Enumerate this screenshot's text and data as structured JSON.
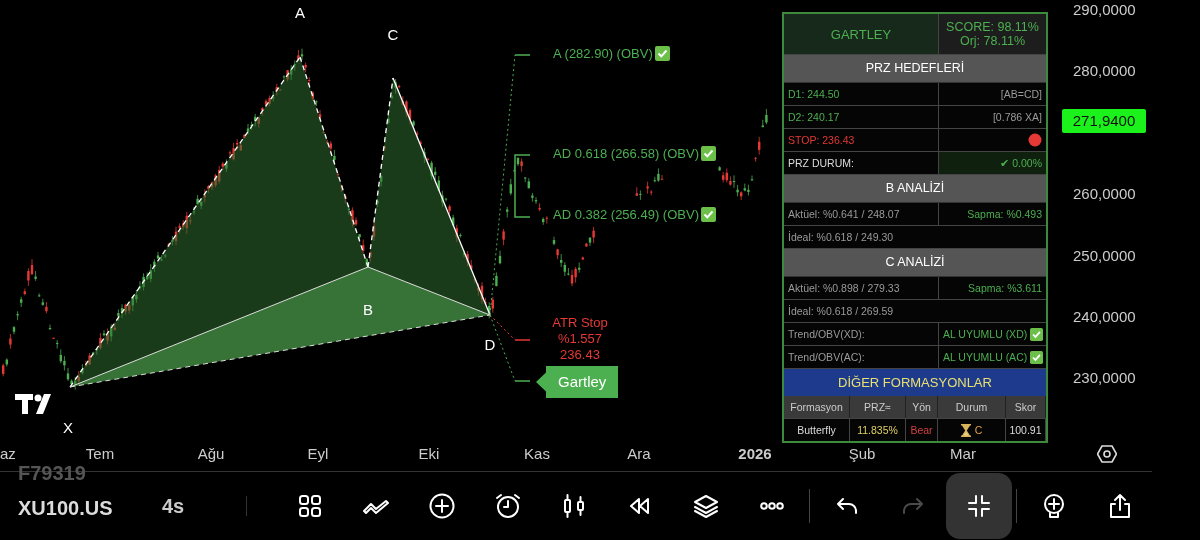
{
  "chart": {
    "pattern_points": [
      {
        "label": "A"
      },
      {
        "label": "C"
      },
      {
        "label": "B"
      },
      {
        "label": "D"
      },
      {
        "label": "X"
      }
    ],
    "annotations": [
      {
        "text": "A (282.90) (OBV)",
        "obv_ok": true
      },
      {
        "text": "AD 0.618 (266.58) (OBV)",
        "obv_ok": true
      },
      {
        "text": "AD 0.382 (256.49) (OBV)",
        "obv_ok": true
      }
    ],
    "stop_label": [
      "ATR Stop",
      "%1.557",
      "236.43"
    ],
    "pattern_name": "Gartley",
    "price_axis": [
      "290,0000",
      "280,0000",
      "260,0000",
      "250,0000",
      "240,0000",
      "230,0000"
    ],
    "current_price": "271,9400",
    "time_axis": [
      {
        "label": "az",
        "kind": "month"
      },
      {
        "label": "Tem",
        "kind": "month"
      },
      {
        "label": "Ağu",
        "kind": "month"
      },
      {
        "label": "Eyl",
        "kind": "month"
      },
      {
        "label": "Eki",
        "kind": "month"
      },
      {
        "label": "Kas",
        "kind": "month"
      },
      {
        "label": "Ara",
        "kind": "month"
      },
      {
        "label": "2026",
        "kind": "year"
      },
      {
        "label": "Şub",
        "kind": "month"
      },
      {
        "label": "Mar",
        "kind": "month"
      }
    ]
  },
  "panel": {
    "title": "GARTLEY",
    "score": "SCORE: 98.11%",
    "orj": "Orj: 78.11%",
    "rows": [
      {
        "kind": "section",
        "text": "PRZ HEDEFLERİ"
      },
      {
        "kind": "pair",
        "left": {
          "text": "D1: 244.50",
          "color": "#4caf50"
        },
        "right": {
          "text": "[AB=CD]",
          "color": "#9a9a9a"
        }
      },
      {
        "kind": "pair",
        "left": {
          "text": "D2: 240.17",
          "color": "#4caf50"
        },
        "right": {
          "text": "[0.786 XA]",
          "color": "#9a9a9a"
        }
      },
      {
        "kind": "stop",
        "left": {
          "text": "STOP: 236.43",
          "color": "#e53935"
        }
      },
      {
        "kind": "status",
        "left": {
          "text": "PRZ DURUM:",
          "color": "#dddddd"
        },
        "right": {
          "text": "✔ 0.00%",
          "color": "#4caf50"
        }
      },
      {
        "kind": "section",
        "text": "B ANALİZİ"
      },
      {
        "kind": "pair",
        "left": {
          "text": "Aktüel: %0.641 / 248.07",
          "color": "#9a9a9a"
        },
        "right": {
          "text": "Sapma: %0.493",
          "color": "#4caf50"
        }
      },
      {
        "kind": "single",
        "left": {
          "text": "İdeal: %0.618 / 249.30",
          "color": "#9a9a9a"
        }
      },
      {
        "kind": "section",
        "text": "C ANALİZİ"
      },
      {
        "kind": "pair",
        "left": {
          "text": "Aktüel: %0.898 / 279.33",
          "color": "#9a9a9a"
        },
        "right": {
          "text": "Sapma: %3.611",
          "color": "#4caf50"
        }
      },
      {
        "kind": "single",
        "left": {
          "text": "İdeal: %0.618 / 269.59",
          "color": "#9a9a9a"
        }
      },
      {
        "kind": "pair",
        "left": {
          "text": "Trend/OBV(XD):",
          "color": "#9a9a9a"
        },
        "right": {
          "text": "AL UYUMLU (XD)",
          "color": "#4caf50",
          "checked": true
        }
      },
      {
        "kind": "pair",
        "left": {
          "text": "Trend/OBV(AC):",
          "color": "#9a9a9a"
        },
        "right": {
          "text": "AL UYUMLU (AC)",
          "color": "#4caf50",
          "checked": true
        }
      }
    ],
    "others_title": "DİĞER FORMASYONLAR",
    "others_columns": [
      "Formasyon",
      "PRZ≈",
      "Yön",
      "Durum",
      "Skor"
    ],
    "others_rows": [
      {
        "name": "Butterfly",
        "prz": "11.835%",
        "direction": "Bear",
        "status": "C",
        "score": "100.91"
      }
    ]
  },
  "bottom_bar": {
    "symbol_above": "F79319",
    "symbol": "XU100.US",
    "interval": "4s",
    "tool_groups": [
      [
        {
          "kind": "grid",
          "selected": false,
          "disabled": false
        },
        {
          "kind": "draw",
          "selected": false,
          "disabled": false
        },
        {
          "kind": "plus",
          "selected": false,
          "disabled": false
        },
        {
          "kind": "alarm",
          "selected": false,
          "disabled": false
        },
        {
          "kind": "candles",
          "selected": false,
          "disabled": false
        },
        {
          "kind": "rewind",
          "selected": false,
          "disabled": false
        },
        {
          "kind": "layers",
          "selected": false,
          "disabled": false
        },
        {
          "kind": "more",
          "selected": false,
          "disabled": false
        }
      ],
      [
        {
          "kind": "undo",
          "selected": false,
          "disabled": false
        },
        {
          "kind": "redo",
          "selected": false,
          "disabled": true
        },
        {
          "kind": "collapse",
          "selected": true,
          "disabled": false
        }
      ],
      [
        {
          "kind": "idea",
          "selected": false,
          "disabled": false
        },
        {
          "kind": "share",
          "selected": false,
          "disabled": false
        }
      ]
    ]
  }
}
